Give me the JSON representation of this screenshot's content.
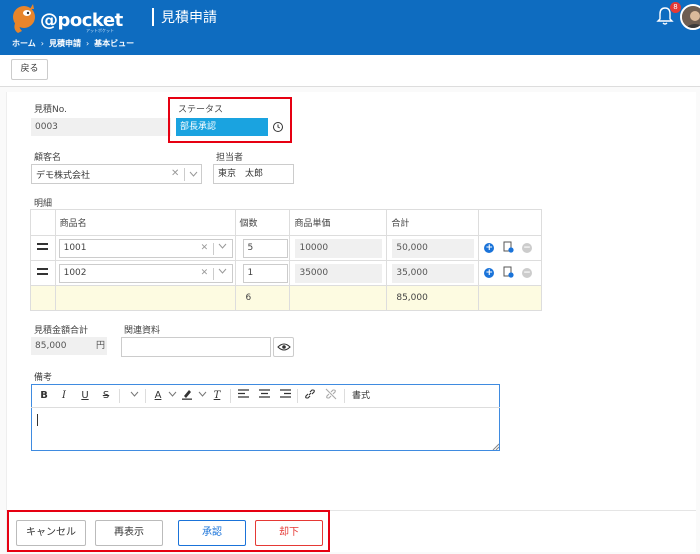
{
  "header": {
    "logo_text": "@pocket",
    "logo_sub": "アットポケット",
    "page_title": "見積申請",
    "notification_count": "8",
    "breadcrumb": [
      "ホーム",
      "見積申請",
      "基本ビュー"
    ]
  },
  "toolbar": {
    "back_label": "戻る"
  },
  "form": {
    "quote_no_label": "見積No.",
    "quote_no_value": "0003",
    "status_label": "ステータス",
    "status_value": "部長承認",
    "customer_label": "顧客名",
    "customer_value": "デモ株式会社",
    "owner_label": "担当者",
    "owner_value": "東京　太郎",
    "details_label": "明細",
    "details": {
      "columns": [
        "商品名",
        "個数",
        "商品単価",
        "合計"
      ],
      "rows": [
        {
          "product": "1001",
          "qty": "5",
          "unit_price": "10000",
          "total": "50,000"
        },
        {
          "product": "1002",
          "qty": "1",
          "unit_price": "35000",
          "total": "35,000"
        }
      ],
      "total_row": {
        "qty": "6",
        "total": "85,000"
      }
    },
    "quote_total_label": "見積金額合計",
    "quote_total_value": "85,000",
    "quote_total_unit": "円",
    "related_docs_label": "関連資料",
    "remarks_label": "備考",
    "editor_toolbar": {
      "bold": "B",
      "italic": "I",
      "underline": "U",
      "strike": "S",
      "text_color": "A",
      "clear_format": "T",
      "format_label": "書式"
    }
  },
  "footer": {
    "cancel_label": "キャンセル",
    "refresh_label": "再表示",
    "approve_label": "承認",
    "reject_label": "却下"
  },
  "colors": {
    "header_bg": "#0e6cc0",
    "status_bg": "#1aa3e0",
    "highlight_red": "#e60012",
    "approve_blue": "#1a73d9",
    "reject_red": "#e53935",
    "total_row_bg": "#fdfbe1"
  }
}
